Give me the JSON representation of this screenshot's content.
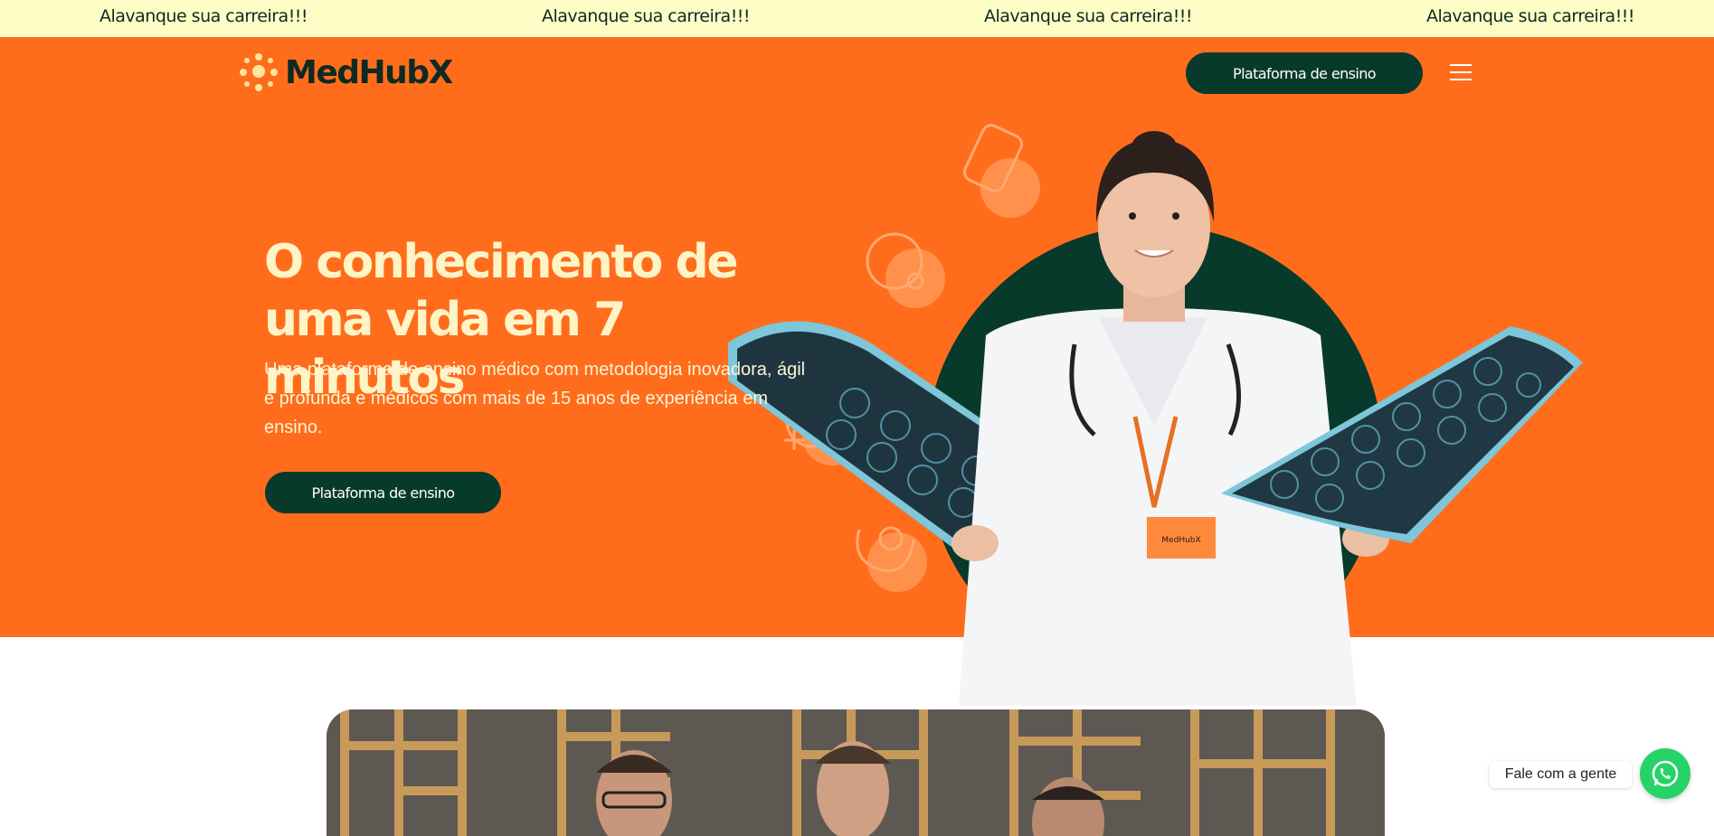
{
  "ticker": {
    "items": [
      "Alavanque sua carreira!!!",
      "Alavanque sua carreira!!!",
      "Alavanque sua carreira!!!",
      "Alavanque sua carreira!!!"
    ]
  },
  "header": {
    "brand": "MedHubX",
    "cta_label": "Plataforma de ensino",
    "menu_icon": "hamburger-menu-icon"
  },
  "hero": {
    "headline_line1": "O conhecimento de",
    "headline_line2": "uma vida em 7 minutos",
    "subtext": "Uma plataforma de ensino médico com metodologia inovadora, ágil e profunda e médicos com mais de 15 anos de experiência em ensino.",
    "cta_label": "Plataforma de ensino",
    "badge_text": "MedHubX"
  },
  "chat": {
    "label": "Fale com a gente",
    "icon": "whatsapp-icon"
  },
  "colors": {
    "ticker_bg": "#FEFDC6",
    "hero_bg": "#FF6D1C",
    "dark_green": "#083a2c",
    "cream": "#FEF4C6",
    "whatsapp": "#25D366"
  }
}
